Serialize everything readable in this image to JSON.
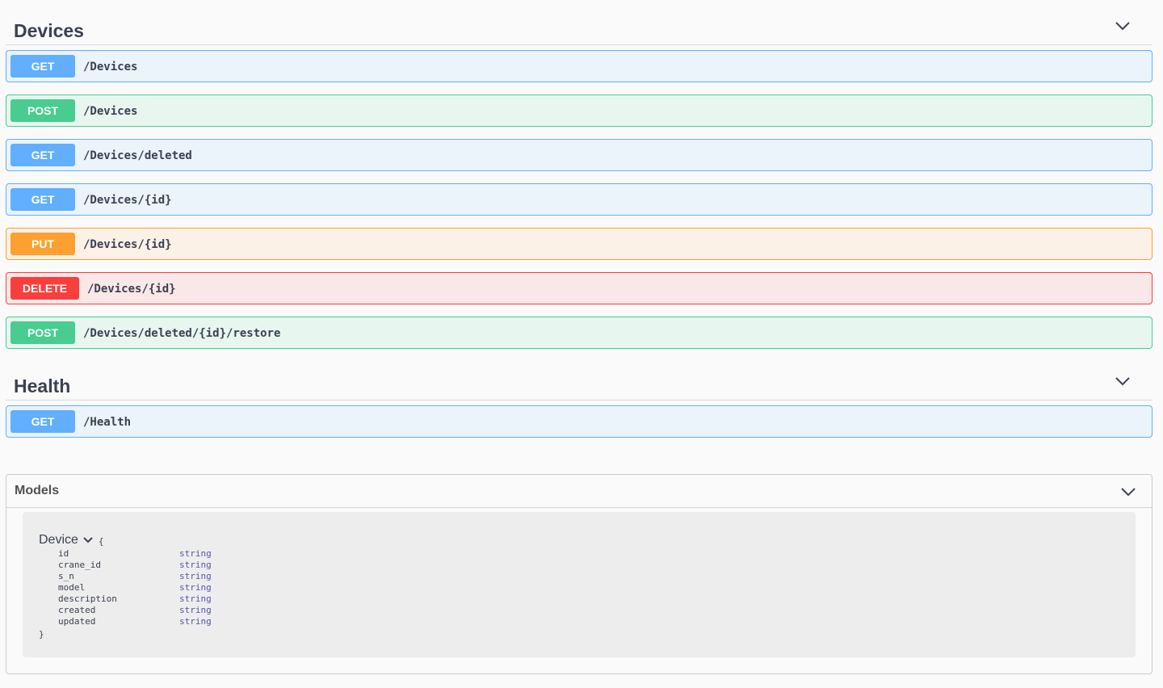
{
  "tags": [
    {
      "title": "Devices",
      "operations": [
        {
          "method": "GET",
          "path": "/Devices"
        },
        {
          "method": "POST",
          "path": "/Devices"
        },
        {
          "method": "GET",
          "path": "/Devices/deleted"
        },
        {
          "method": "GET",
          "path": "/Devices/{id}"
        },
        {
          "method": "PUT",
          "path": "/Devices/{id}"
        },
        {
          "method": "DELETE",
          "path": "/Devices/{id}"
        },
        {
          "method": "POST",
          "path": "/Devices/deleted/{id}/restore"
        }
      ]
    },
    {
      "title": "Health",
      "operations": [
        {
          "method": "GET",
          "path": "/Health"
        }
      ]
    }
  ],
  "models": {
    "title": "Models",
    "model": {
      "name": "Device",
      "open_brace": "{",
      "close_brace": "}",
      "properties": [
        {
          "name": "id",
          "type": "string"
        },
        {
          "name": "crane_id",
          "type": "string"
        },
        {
          "name": "s_n",
          "type": "string"
        },
        {
          "name": "model",
          "type": "string"
        },
        {
          "name": "description",
          "type": "string"
        },
        {
          "name": "created",
          "type": "string"
        },
        {
          "name": "updated",
          "type": "string"
        }
      ]
    }
  },
  "icons": {
    "section_toggle": "chevron-down-icon",
    "model_toggle": "chevron-down-icon"
  },
  "colors": {
    "get": "#61affe",
    "post": "#49cc90",
    "put": "#fca130",
    "delete": "#f93e3e"
  }
}
